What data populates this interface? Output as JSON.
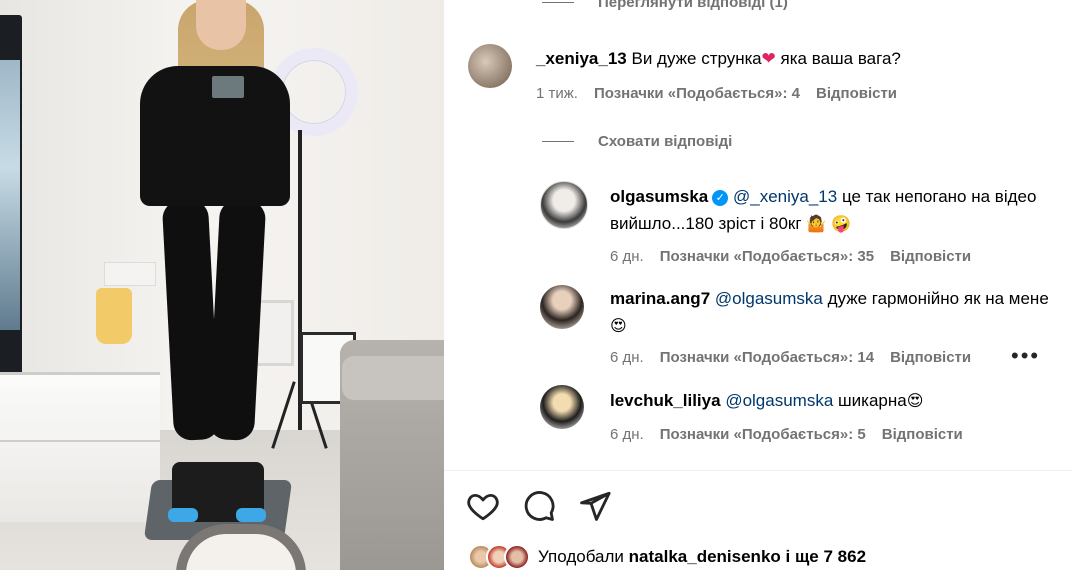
{
  "top_toggle": {
    "label": "Переглянути відповіді (1)"
  },
  "comment_main": {
    "username": "_xeniya_13",
    "text_before": "Ви дуже стрункa",
    "text_after": "яка ваша вага?",
    "time": "1 тиж.",
    "likes": "Позначки «Подобається»: 4",
    "reply": "Відповісти"
  },
  "hide_toggle": {
    "label": "Сховати відповіді"
  },
  "replies": [
    {
      "username": "olgasumska",
      "verified": true,
      "mention": "@_xeniya_13",
      "text": "це так непогано на відео вийшло...180 зріст і 80кг",
      "emoji_1": "🤷",
      "emoji_2": "🤪",
      "time": "6 дн.",
      "likes": "Позначки «Подобається»: 35",
      "reply": "Відповісти"
    },
    {
      "username": "marina.ang7",
      "mention": "@olgasumska",
      "text": "дуже гармонійно як на мене",
      "emoji_1": "😍",
      "time": "6 дн.",
      "likes": "Позначки «Подобається»: 14",
      "reply": "Відповісти",
      "more": "•••"
    },
    {
      "username": "levchuk_liliya",
      "mention": "@olgasumska",
      "text": "шикарна",
      "emoji_1": "😍",
      "time": "6 дн.",
      "likes": "Позначки «Подобається»: 5",
      "reply": "Відповісти"
    }
  ],
  "actions": {
    "like_icon": "heart-icon",
    "comment_icon": "comment-icon",
    "share_icon": "share-icon"
  },
  "likes_summary": {
    "prefix": "Уподобали",
    "user": "natalka_denisenko",
    "suffix": "і ще 7 862"
  },
  "colors": {
    "mention": "#00376b",
    "meta": "#737373",
    "verified": "#0095f6",
    "heart": "#e0245e"
  }
}
